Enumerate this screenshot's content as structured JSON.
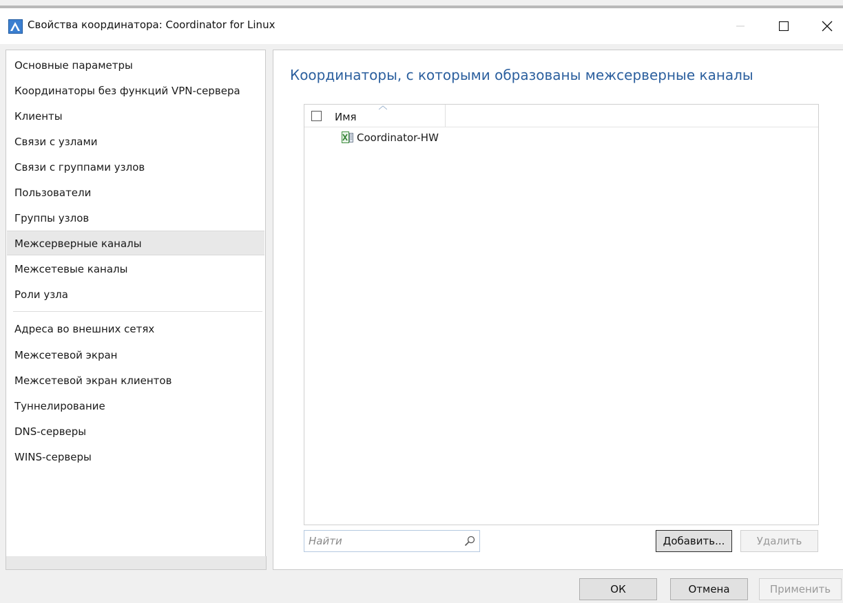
{
  "window": {
    "title": "Свойства координатора: Coordinator for Linux"
  },
  "nav": {
    "items": [
      {
        "label": "Основные параметры"
      },
      {
        "label": "Координаторы без функций VPN-сервера"
      },
      {
        "label": "Клиенты"
      },
      {
        "label": "Связи с узлами"
      },
      {
        "label": "Связи с группами узлов"
      },
      {
        "label": "Пользователи"
      },
      {
        "label": "Группы узлов"
      },
      {
        "label": "Межсерверные каналы",
        "selected": true
      },
      {
        "label": "Межсетевые каналы"
      },
      {
        "label": "Роли узла"
      },
      {
        "label": "Адреса во внешних сетях"
      },
      {
        "label": "Межсетевой экран"
      },
      {
        "label": "Межсетевой экран клиентов"
      },
      {
        "label": "Туннелирование"
      },
      {
        "label": "DNS-серверы"
      },
      {
        "label": "WINS-серверы"
      }
    ]
  },
  "main": {
    "title": "Координаторы, с которыми образованы межсерверные каналы",
    "list": {
      "column_name": "Имя",
      "rows": [
        {
          "name": "Coordinator-HW",
          "icon": "coordinator-icon"
        }
      ]
    },
    "search": {
      "placeholder": "Найти",
      "value": ""
    },
    "add_label": "Добавить...",
    "delete_label": "Удалить"
  },
  "footer": {
    "ok_label": "ОК",
    "cancel_label": "Отмена",
    "apply_label": "Применить"
  },
  "colors": {
    "accent_title": "#2b5f9e",
    "selected_bg": "#e8e8e8"
  }
}
